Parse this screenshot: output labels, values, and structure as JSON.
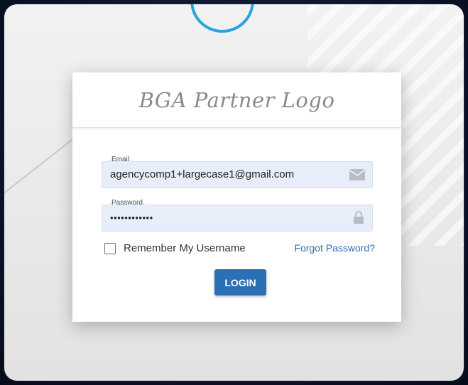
{
  "card": {
    "logo_text": "BGA Partner Logo"
  },
  "email": {
    "label": "Email",
    "value": "agencycomp1+largecase1@gmail.com",
    "icon": "envelope-icon"
  },
  "password": {
    "label": "Password",
    "value": "••••••••••••",
    "icon": "lock-icon"
  },
  "remember": {
    "label": "Remember My Username",
    "checked": false
  },
  "forgot_link": "Forgot Password?",
  "login_button": "LOGIN",
  "colors": {
    "accent": "#2b6fb5",
    "link": "#2e6fb7",
    "field_bg": "#e8eef9",
    "circle": "#29a3e0"
  }
}
